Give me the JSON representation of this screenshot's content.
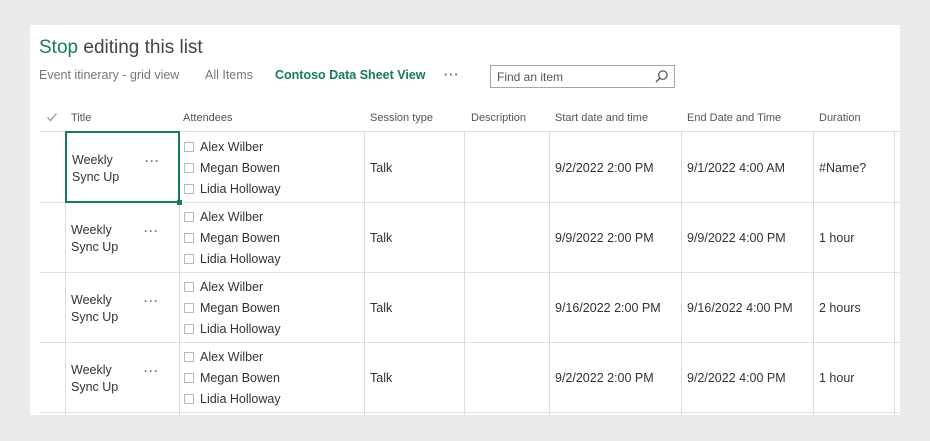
{
  "header": {
    "title_action": "Stop",
    "title_rest": " editing this list"
  },
  "views": {
    "items": [
      "Event itinerary - grid view",
      "All Items",
      "Contoso Data Sheet View"
    ],
    "more": "···"
  },
  "search": {
    "placeholder": "Find an item",
    "icon": "search-icon"
  },
  "columns": [
    "Title",
    "Attendees",
    "Session type",
    "Description",
    "Start date and time",
    "End Date and Time",
    "Duration"
  ],
  "rows": [
    {
      "title": "Weekly Sync Up",
      "attendees": [
        "Alex Wilber",
        "Megan Bowen",
        "Lidia Holloway"
      ],
      "session_type": "Talk",
      "description": "",
      "start": "9/2/2022 2:00 PM",
      "end": "9/1/2022 4:00 AM",
      "duration": "#Name?"
    },
    {
      "title": "Weekly Sync Up",
      "attendees": [
        "Alex Wilber",
        "Megan Bowen",
        "Lidia Holloway"
      ],
      "session_type": "Talk",
      "description": "",
      "start": "9/9/2022 2:00 PM",
      "end": "9/9/2022 4:00 PM",
      "duration": "1 hour"
    },
    {
      "title": "Weekly Sync Up",
      "attendees": [
        "Alex Wilber",
        "Megan Bowen",
        "Lidia Holloway"
      ],
      "session_type": "Talk",
      "description": "",
      "start": "9/16/2022 2:00 PM",
      "end": "9/16/2022 4:00 PM",
      "duration": "2 hours"
    },
    {
      "title": "Weekly Sync Up",
      "attendees": [
        "Alex Wilber",
        "Megan Bowen",
        "Lidia Holloway"
      ],
      "session_type": "Talk",
      "description": "",
      "start": "9/2/2022 2:00 PM",
      "end": "9/2/2022 4:00 PM",
      "duration": "1 hour"
    }
  ],
  "row_menu": "···",
  "colors": {
    "accent": "#1a7a5e",
    "background": "#ebebeb",
    "panel": "#ffffff"
  }
}
